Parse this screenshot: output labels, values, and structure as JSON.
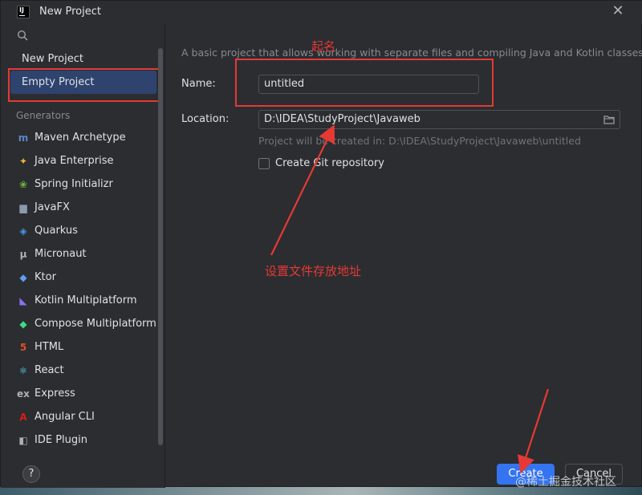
{
  "window": {
    "title": "New Project",
    "app_icon_text": "IJ",
    "close_symbol": "✕"
  },
  "sidebar": {
    "search_icon": "search-icon",
    "top_items": [
      {
        "label": "New Project"
      },
      {
        "label": "Empty Project",
        "selected": true
      }
    ],
    "group_label": "Generators",
    "generators": [
      {
        "label": "Maven Archetype",
        "icon": "maven-icon",
        "glyph": "m",
        "color": "#5d87c6"
      },
      {
        "label": "Java Enterprise",
        "icon": "java-enterprise-icon",
        "glyph": "✦",
        "color": "#f0b33a"
      },
      {
        "label": "Spring Initializr",
        "icon": "spring-icon",
        "glyph": "❀",
        "color": "#6cb33e"
      },
      {
        "label": "JavaFX",
        "icon": "folder-icon",
        "glyph": "▆",
        "color": "#8a9bb0"
      },
      {
        "label": "Quarkus",
        "icon": "quarkus-icon",
        "glyph": "◈",
        "color": "#4695eb"
      },
      {
        "label": "Micronaut",
        "icon": "micronaut-icon",
        "glyph": "μ",
        "color": "#b0b0b0"
      },
      {
        "label": "Ktor",
        "icon": "ktor-icon",
        "glyph": "◆",
        "color": "#5f9ef5"
      },
      {
        "label": "Kotlin Multiplatform",
        "icon": "kotlin-icon",
        "glyph": "◣",
        "color": "#8f6df7"
      },
      {
        "label": "Compose Multiplatform",
        "icon": "compose-icon",
        "glyph": "◆",
        "color": "#3ddc84"
      },
      {
        "label": "HTML",
        "icon": "html5-icon",
        "glyph": "5",
        "color": "#e44d26"
      },
      {
        "label": "React",
        "icon": "react-icon",
        "glyph": "⚛",
        "color": "#61dafb"
      },
      {
        "label": "Express",
        "icon": "express-icon",
        "glyph": "ex",
        "color": "#b0b0b0"
      },
      {
        "label": "Angular CLI",
        "icon": "angular-icon",
        "glyph": "A",
        "color": "#dd1b16"
      },
      {
        "label": "IDE Plugin",
        "icon": "plugin-icon",
        "glyph": "◧",
        "color": "#b0b0b0"
      }
    ],
    "help_label": "?"
  },
  "main": {
    "description": "A basic project that allows working with separate files and compiling Java and Kotlin classes.",
    "name_label": "Name:",
    "name_value": "untitled",
    "location_label": "Location:",
    "location_value": "D:\\IDEA\\StudyProject\\Javaweb",
    "hint": "Project will be created in: D:\\IDEA\\StudyProject\\Javaweb\\untitled",
    "git_label": "Create Git repository"
  },
  "buttons": {
    "create": "Create",
    "cancel": "Cancel"
  },
  "annotations": {
    "name_note": "起名",
    "location_note": "设置文件存放地址",
    "color": "#e53935"
  },
  "watermark": "@稀土掘金技术社区"
}
